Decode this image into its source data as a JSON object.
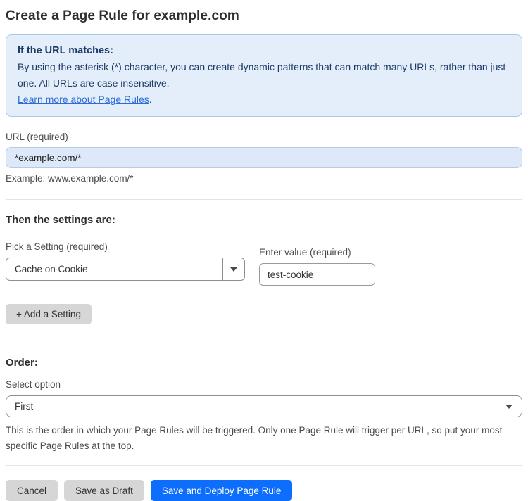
{
  "page": {
    "title": "Create a Page Rule for example.com"
  },
  "info_box": {
    "heading": "If the URL matches:",
    "body": "By using the asterisk (*) character, you can create dynamic patterns that can match many URLs, rather than just one. All URLs are case insensitive.",
    "link_label": "Learn more about Page Rules",
    "link_suffix": "."
  },
  "url_field": {
    "label": "URL (required)",
    "value": "*example.com/*",
    "example": "Example: www.example.com/*"
  },
  "settings": {
    "heading": "Then the settings are:",
    "setting_label": "Pick a Setting (required)",
    "setting_selected": "Cache on Cookie",
    "value_label": "Enter value (required)",
    "value_value": "test-cookie",
    "add_button_label": "+ Add a Setting"
  },
  "order": {
    "heading": "Order:",
    "select_label": "Select option",
    "selected_option": "First",
    "help_text": "This is the order in which your Page Rules will be triggered. Only one Page Rule will trigger per URL, so put your most specific Page Rules at the top."
  },
  "actions": {
    "cancel_label": "Cancel",
    "save_draft_label": "Save as Draft",
    "save_deploy_label": "Save and Deploy Page Rule"
  },
  "colors": {
    "accent_blue": "#0d6efd",
    "info_bg": "#e3eefa",
    "info_border": "#aac9ea",
    "info_text": "#1d3a66",
    "link_blue": "#2f6bd8",
    "input_blue_bg": "#dde9f8",
    "gray_btn_bg": "#d6d6d6"
  }
}
